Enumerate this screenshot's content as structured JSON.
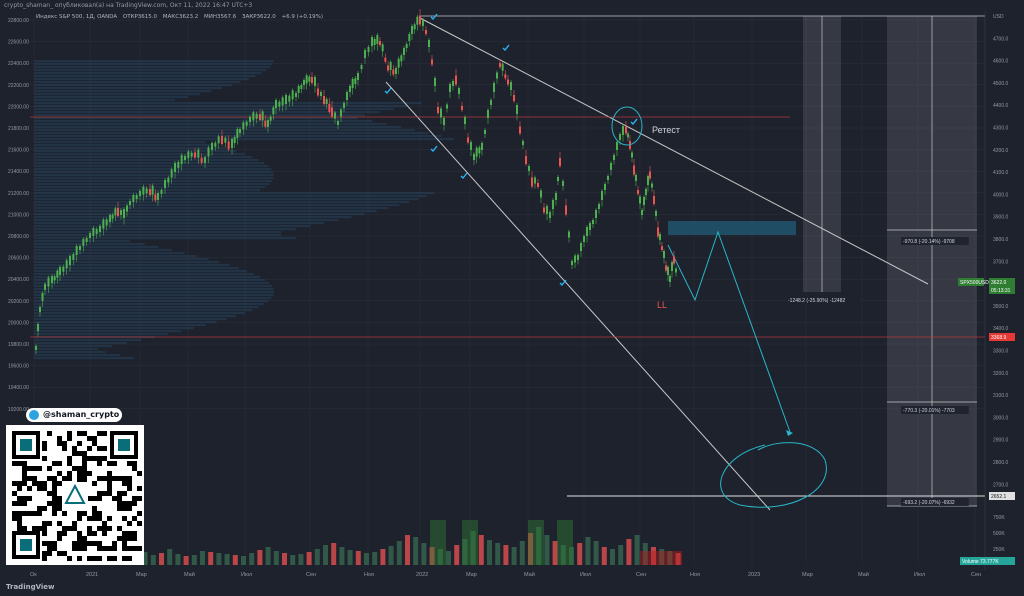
{
  "header": {
    "top_line": "crypto_shaman_ опубликовал(а) на TradingView.com, Окт 11, 2022 16:47 UTC+3",
    "legend": {
      "symbol": "Индекс S&P 500, 1Д, OANDA",
      "open": "ОТКР3615.0",
      "high": "МАКС3623.2",
      "low": "МИН3567.6",
      "close": "ЗАКР3622.0",
      "change": "+6.9 (+0.19%)"
    }
  },
  "colors": {
    "background": "#1e222d",
    "up": "#26a69a",
    "up_green": "#4caf50",
    "down": "#ef5350",
    "line": "#c8c8c8",
    "cyan": "#29b6c8",
    "red_line": "#b23a3a"
  },
  "chart_data": {
    "type": "candlestick",
    "left_axis_ticks": [
      "22800.00",
      "22600.00",
      "22400.00",
      "22200.00",
      "22000.00",
      "21800.00",
      "21600.00",
      "21400.00",
      "21200.00",
      "21000.00",
      "20800.00",
      "20600.00",
      "20400.00",
      "20200.00",
      "20000.00",
      "19800.00",
      "19600.00",
      "19400.00",
      "19200.00"
    ],
    "right_axis_ticks": [
      "USD",
      "4700.0",
      "4600.0",
      "4500.0",
      "4400.0",
      "4300.0",
      "4200.0",
      "4100.0",
      "4000.0",
      "3900.0",
      "3800.0",
      "3700.0",
      "3600.0",
      "3500.0",
      "3400.0",
      "3300.0",
      "3200.0",
      "3100.0",
      "3000.0",
      "2900.0",
      "2800.0",
      "2700.0"
    ],
    "volume_ticks": [
      "750K",
      "500K",
      "250K"
    ],
    "x_ticks": [
      "Ок",
      "2021",
      "Мар",
      "Май",
      "Июл",
      "Сен",
      "Ноя",
      "2022",
      "Мар",
      "Май",
      "Июл",
      "Сен",
      "Ноя",
      "2023",
      "Мар",
      "Май",
      "Июл",
      "Сен"
    ],
    "price_tags": {
      "symbol": "SPX500USD",
      "price": "3622.0",
      "timer": "05:13:31",
      "red": "3368.9",
      "level": "2652.1",
      "volume": "Volume 73.777K"
    },
    "annotations": {
      "retest": "Ретест",
      "ll": "LL",
      "measure1": "-1248.2 (-25.90%) -12482",
      "measure2": "-970.8 (-20.14%) -9708",
      "measure3": "-770.3 (-20.01%) -7703",
      "measure4": "-693.2 (-20.07%) -6932"
    },
    "series_path": [
      [
        36,
        350
      ],
      [
        40,
        312
      ],
      [
        45,
        290
      ],
      [
        52,
        283
      ],
      [
        60,
        275
      ],
      [
        70,
        265
      ],
      [
        80,
        250
      ],
      [
        90,
        238
      ],
      [
        100,
        232
      ],
      [
        110,
        222
      ],
      [
        118,
        212
      ],
      [
        124,
        218
      ],
      [
        130,
        205
      ],
      [
        140,
        196
      ],
      [
        150,
        192
      ],
      [
        158,
        200
      ],
      [
        165,
        188
      ],
      [
        175,
        172
      ],
      [
        185,
        160
      ],
      [
        195,
        155
      ],
      [
        205,
        163
      ],
      [
        212,
        150
      ],
      [
        222,
        140
      ],
      [
        232,
        148
      ],
      [
        240,
        133
      ],
      [
        250,
        122
      ],
      [
        260,
        117
      ],
      [
        268,
        127
      ],
      [
        276,
        108
      ],
      [
        286,
        104
      ],
      [
        296,
        97
      ],
      [
        304,
        85
      ],
      [
        312,
        80
      ],
      [
        318,
        92
      ],
      [
        324,
        100
      ],
      [
        332,
        112
      ],
      [
        338,
        125
      ],
      [
        344,
        108
      ],
      [
        350,
        92
      ],
      [
        358,
        80
      ],
      [
        365,
        58
      ],
      [
        372,
        46
      ],
      [
        380,
        43
      ],
      [
        388,
        68
      ],
      [
        396,
        74
      ],
      [
        404,
        55
      ],
      [
        412,
        34
      ],
      [
        420,
        20
      ],
      [
        426,
        32
      ],
      [
        432,
        62
      ],
      [
        438,
        110
      ],
      [
        444,
        125
      ],
      [
        450,
        92
      ],
      [
        456,
        80
      ],
      [
        462,
        108
      ],
      [
        468,
        140
      ],
      [
        474,
        160
      ],
      [
        482,
        150
      ],
      [
        488,
        118
      ],
      [
        494,
        92
      ],
      [
        500,
        65
      ],
      [
        508,
        82
      ],
      [
        514,
        98
      ],
      [
        520,
        130
      ],
      [
        526,
        160
      ],
      [
        532,
        182
      ],
      [
        538,
        185
      ],
      [
        544,
        210
      ],
      [
        550,
        218
      ],
      [
        556,
        200
      ],
      [
        560,
        162
      ],
      [
        566,
        210
      ],
      [
        572,
        265
      ],
      [
        578,
        260
      ],
      [
        584,
        242
      ],
      [
        590,
        230
      ],
      [
        596,
        218
      ],
      [
        602,
        200
      ],
      [
        608,
        180
      ],
      [
        614,
        160
      ],
      [
        620,
        140
      ],
      [
        626,
        130
      ],
      [
        630,
        145
      ],
      [
        634,
        170
      ],
      [
        638,
        192
      ],
      [
        642,
        215
      ],
      [
        646,
        195
      ],
      [
        650,
        175
      ],
      [
        654,
        200
      ],
      [
        658,
        232
      ],
      [
        662,
        248
      ],
      [
        666,
        268
      ],
      [
        670,
        282
      ],
      [
        674,
        260
      ],
      [
        678,
        285
      ]
    ],
    "volume_series": [
      12,
      14,
      10,
      9,
      11,
      13,
      8,
      12,
      15,
      10,
      9,
      11,
      14,
      13,
      10,
      12,
      16,
      11,
      9,
      10,
      14,
      13,
      12,
      11,
      10,
      9,
      12,
      15,
      18,
      14,
      12,
      10,
      11,
      13,
      16,
      20,
      22,
      18,
      15,
      14,
      12,
      13,
      16,
      19,
      24,
      30,
      28,
      22,
      18,
      16,
      14,
      20,
      26,
      34,
      30,
      25,
      22,
      20,
      18,
      24,
      32,
      38,
      30,
      24,
      20,
      18,
      22,
      28,
      24,
      18,
      16,
      20,
      26,
      30,
      22,
      18,
      16,
      14,
      12
    ]
  }
}
